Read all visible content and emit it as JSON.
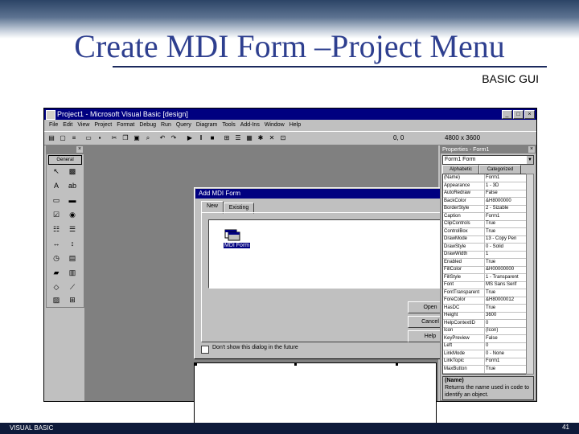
{
  "slide": {
    "title": "Create MDI Form –Project Menu",
    "subtitle": "BASIC GUI",
    "footer_left": "VISUAL BASIC",
    "page_number": "41"
  },
  "vb": {
    "title": "Project1 - Microsoft Visual Basic [design]",
    "menu": [
      "File",
      "Edit",
      "View",
      "Project",
      "Format",
      "Debug",
      "Run",
      "Query",
      "Diagram",
      "Tools",
      "Add-Ins",
      "Window",
      "Help"
    ],
    "toolbar_position": "0, 0",
    "toolbar_size": "4800 x 3600",
    "toolbox_title": "General",
    "dialog": {
      "title": "Add MDI Form",
      "tabs": [
        "New",
        "Existing"
      ],
      "item_label": "MDI Form",
      "open_button": "Open",
      "cancel_button": "Cancel",
      "help_button": "Help",
      "checkbox_label": "Don't show this dialog in the future"
    },
    "properties": {
      "title": "Properties - Form1",
      "object": "Form1 Form",
      "tabs": [
        "Alphabetic",
        "Categorized"
      ],
      "rows": [
        {
          "name": "(Name)",
          "value": "Form1"
        },
        {
          "name": "Appearance",
          "value": "1 - 3D"
        },
        {
          "name": "AutoRedraw",
          "value": "False"
        },
        {
          "name": "BackColor",
          "value": "&H8000000"
        },
        {
          "name": "BorderStyle",
          "value": "2 - Sizable"
        },
        {
          "name": "Caption",
          "value": "Form1"
        },
        {
          "name": "ClipControls",
          "value": "True"
        },
        {
          "name": "ControlBox",
          "value": "True"
        },
        {
          "name": "DrawMode",
          "value": "13 - Copy Pen"
        },
        {
          "name": "DrawStyle",
          "value": "0 - Solid"
        },
        {
          "name": "DrawWidth",
          "value": "1"
        },
        {
          "name": "Enabled",
          "value": "True"
        },
        {
          "name": "FillColor",
          "value": "&H00000000"
        },
        {
          "name": "FillStyle",
          "value": "1 - Transparent"
        },
        {
          "name": "Font",
          "value": "MS Sans Serif"
        },
        {
          "name": "FontTransparent",
          "value": "True"
        },
        {
          "name": "ForeColor",
          "value": "&H80000012"
        },
        {
          "name": "HasDC",
          "value": "True"
        },
        {
          "name": "Height",
          "value": "3600"
        },
        {
          "name": "HelpContextID",
          "value": "0"
        },
        {
          "name": "Icon",
          "value": "(Icon)"
        },
        {
          "name": "KeyPreview",
          "value": "False"
        },
        {
          "name": "Left",
          "value": "0"
        },
        {
          "name": "LinkMode",
          "value": "0 - None"
        },
        {
          "name": "LinkTopic",
          "value": "Form1"
        },
        {
          "name": "MaxButton",
          "value": "True"
        }
      ],
      "desc_name": "(Name)",
      "desc_text": "Returns the name used in code to identify an object."
    }
  }
}
